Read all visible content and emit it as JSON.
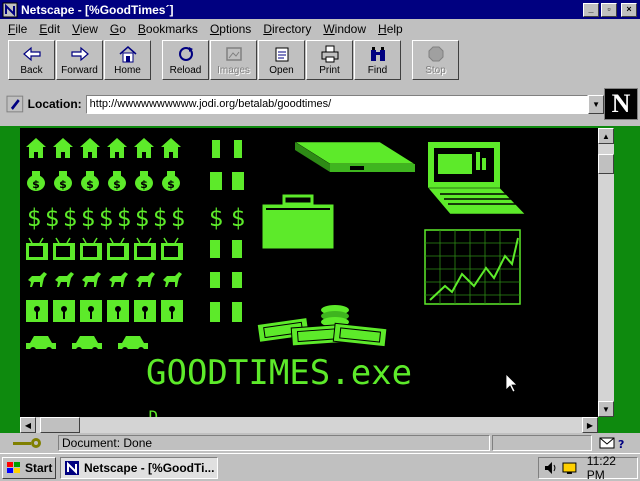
{
  "window": {
    "title": "Netscape - [%GoodTimes´]",
    "minimize": "_",
    "maximize": "▫",
    "close": "×"
  },
  "menu": [
    "File",
    "Edit",
    "View",
    "Go",
    "Bookmarks",
    "Options",
    "Directory",
    "Window",
    "Help"
  ],
  "menu_underline": [
    "F",
    "E",
    "V",
    "G",
    "B",
    "O",
    "D",
    "W",
    "H"
  ],
  "toolbar": {
    "back": "Back",
    "forward": "Forward",
    "home": "Home",
    "reload": "Reload",
    "images": "Images",
    "open": "Open",
    "print": "Print",
    "find": "Find",
    "stop": "Stop"
  },
  "location": {
    "label": "Location:",
    "url": "http://wwwwwwwwww.jodi.org/betalab/goodtimes/"
  },
  "page": {
    "headline": "GOODTIMES.exe",
    "partial_text": "_ _ D",
    "accent_color": "#5dea2a",
    "background": "#000000"
  },
  "status": {
    "text": "Document: Done"
  },
  "taskbar": {
    "start": "Start",
    "task": "Netscape - [%GoodTi...",
    "clock": "11:22 PM"
  },
  "icons": {
    "title": "netscape-icon",
    "location": "bookmark-icon",
    "status_left": "security-key-icon",
    "status_right": "mail-icon"
  }
}
